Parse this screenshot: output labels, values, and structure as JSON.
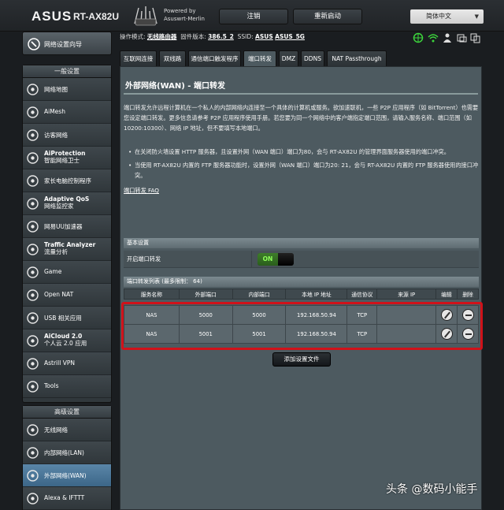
{
  "header": {
    "brand": "ASUS",
    "model": "RT-AX82U",
    "powered_line1": "Powered by",
    "powered_line2": "Asuswrt-Merlin",
    "logout": "注销",
    "reboot": "重新启动",
    "language": "简体中文"
  },
  "sidebar": {
    "qis": "网络设置向导",
    "general_title": "一般设置",
    "general_items": [
      {
        "label": "网络地图",
        "icon": "network-map-icon"
      },
      {
        "label": "AiMesh",
        "icon": "aimesh-icon"
      },
      {
        "label": "访客网络",
        "icon": "guest-network-icon"
      },
      {
        "label": "AiProtection",
        "sub": "智能网络卫士",
        "icon": "shield-icon"
      },
      {
        "label": "家长电脑控制程序",
        "icon": "parental-control-icon"
      },
      {
        "label": "Adaptive QoS",
        "sub": "网络监控家",
        "icon": "qos-icon"
      },
      {
        "label": "网易UU加速器",
        "icon": "uu-accelerator-icon"
      },
      {
        "label": "Traffic Analyzer",
        "sub": "流量分析",
        "icon": "traffic-analyzer-icon"
      },
      {
        "label": "Game",
        "icon": "gamepad-icon"
      },
      {
        "label": "Open NAT",
        "icon": "open-nat-icon"
      },
      {
        "label": "USB 相关应用",
        "icon": "usb-icon"
      },
      {
        "label": "AiCloud 2.0",
        "sub": "个人云 2.0 应用",
        "icon": "cloud-icon"
      },
      {
        "label": "Astrill VPN",
        "icon": "astrill-vpn-icon"
      },
      {
        "label": "Tools",
        "icon": "tools-icon"
      }
    ],
    "advanced_title": "高级设置",
    "advanced_items": [
      {
        "label": "无线网络",
        "icon": "wireless-icon"
      },
      {
        "label": "内部网络(LAN)",
        "icon": "lan-icon"
      },
      {
        "label": "外部网络(WAN)",
        "icon": "wan-globe-icon"
      },
      {
        "label": "Alexa & IFTTT",
        "icon": "alexa-icon"
      }
    ]
  },
  "status": {
    "mode_label": "操作模式:",
    "mode_value": "无线路由器",
    "fw_label": "固件版本:",
    "fw_value": "386.5_2",
    "ssid_label": "SSID:",
    "ssid_1": "ASUS",
    "ssid_2": "ASUS_5G"
  },
  "tabs": [
    "互联网连接",
    "双线路",
    "通信端口触发程序",
    "端口转发",
    "DMZ",
    "DDNS",
    "NAT Passthrough"
  ],
  "page": {
    "title": "外部网络(WAN) - 端口转发",
    "desc": "端口转发允许远程计算机在一个私人的内部网络内连接至一个具体的计算机或服务。欲加速联机，一些 P2P 应用程序（如 BitTorrent）也需要您设定端口转发。更多信息请参考 P2P 应用程序使用手册。若您要为同一个网络中的客户端指定端口范围，请输入服务名称、端口范围（如 10200:10300）、网络 IP 地址，但不要填写本地端口。",
    "bullet1": "在关闭防火墙设置 HTTP 服务器，且设置外网（WAN 端口）端口为80，会与 RT-AX82U 的管理界面服务器使用的端口冲突。",
    "bullet2": "当使用 RT-AX82U 内置的 FTP 服务器功能时，设置外网（WAN 端口）端口为20: 21，会与 RT-AX82U 内置的 FTP 服务器使用的接口冲突。",
    "faq": "端口转发 FAQ",
    "basic_header": "基本设置",
    "enable_label": "开启端口转发",
    "toggle_on": "ON",
    "list_header": "端口转发列表 (最多限制： 64)",
    "add_button": "添加设置文件"
  },
  "table": {
    "headers": [
      "服务名称",
      "外部端口",
      "内部端口",
      "本地 IP 地址",
      "通信协议",
      "来源 IP",
      "编辑",
      "删除"
    ],
    "rows": [
      {
        "name": "NAS",
        "ext": "5000",
        "int": "5000",
        "ip": "192.168.50.94",
        "proto": "TCP",
        "src": ""
      },
      {
        "name": "NAS",
        "ext": "5001",
        "int": "5001",
        "ip": "192.168.50.94",
        "proto": "TCP",
        "src": ""
      }
    ]
  },
  "watermark": "头条 @数码小能手",
  "colors": {
    "highlight": "#d0121a",
    "toggle_on": "#8fff5a",
    "active_nav": "#4a7698"
  }
}
